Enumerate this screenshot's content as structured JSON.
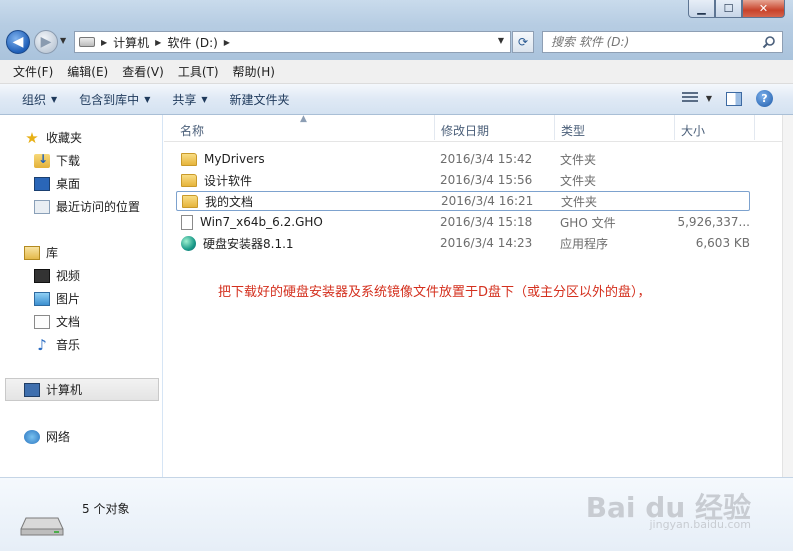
{
  "address": {
    "crumbs": [
      "计算机",
      "软件 (D:)"
    ]
  },
  "search": {
    "placeholder": "搜索 软件 (D:)"
  },
  "menu": [
    "文件(F)",
    "编辑(E)",
    "查看(V)",
    "工具(T)",
    "帮助(H)"
  ],
  "commands": [
    "组织",
    "包含到库中",
    "共享",
    "新建文件夹"
  ],
  "nav": {
    "favorites": "收藏夹",
    "downloads": "下载",
    "desktop": "桌面",
    "recent": "最近访问的位置",
    "libraries": "库",
    "videos": "视频",
    "pictures": "图片",
    "documents": "文档",
    "music": "音乐",
    "computer": "计算机",
    "network": "网络"
  },
  "columns": [
    "名称",
    "修改日期",
    "类型",
    "大小"
  ],
  "files": [
    {
      "name": "MyDrivers",
      "date": "2016/3/4 15:42",
      "type": "文件夹",
      "size": "",
      "icon": "folder-icon"
    },
    {
      "name": "设计软件",
      "date": "2016/3/4 15:56",
      "type": "文件夹",
      "size": "",
      "icon": "folder-icon"
    },
    {
      "name": "我的文档",
      "date": "2016/3/4 16:21",
      "type": "文件夹",
      "size": "",
      "icon": "folder-icon",
      "selected": true
    },
    {
      "name": "Win7_x64b_6.2.GHO",
      "date": "2016/3/4 15:18",
      "type": "GHO 文件",
      "size": "5,926,337...",
      "icon": "file-icon"
    },
    {
      "name": "硬盘安装器8.1.1",
      "date": "2016/3/4 14:23",
      "type": "应用程序",
      "size": "6,603 KB",
      "icon": "app-icon"
    }
  ],
  "annotation": "把下载好的硬盘安装器及系统镜像文件放置于D盘下（或主分区以外的盘），",
  "details": {
    "count": "5 个对象"
  },
  "watermark": {
    "main": "Bai du 经验",
    "sub": "jingyan.baidu.com"
  },
  "colors": {
    "annotation": "#d4301e",
    "selection_border": "#7da2ce"
  }
}
